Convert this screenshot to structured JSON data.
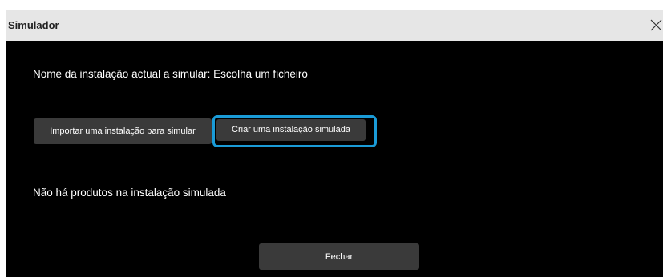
{
  "window": {
    "title": "Simulador",
    "close_icon": "close-icon"
  },
  "main": {
    "installation_label": "Nome da instalação actual a simular:",
    "installation_value": "Escolha um ficheiro",
    "buttons": {
      "import_label": "Importar uma instalação para simular",
      "create_label": "Criar uma instalação simulada"
    },
    "empty_message": "Não há produtos na instalação simulada"
  },
  "footer": {
    "close_label": "Fechar"
  },
  "colors": {
    "background": "#000000",
    "titlebar": "#e6e6e6",
    "button": "#3a3a3a",
    "focus_ring": "#1a9bd7"
  }
}
